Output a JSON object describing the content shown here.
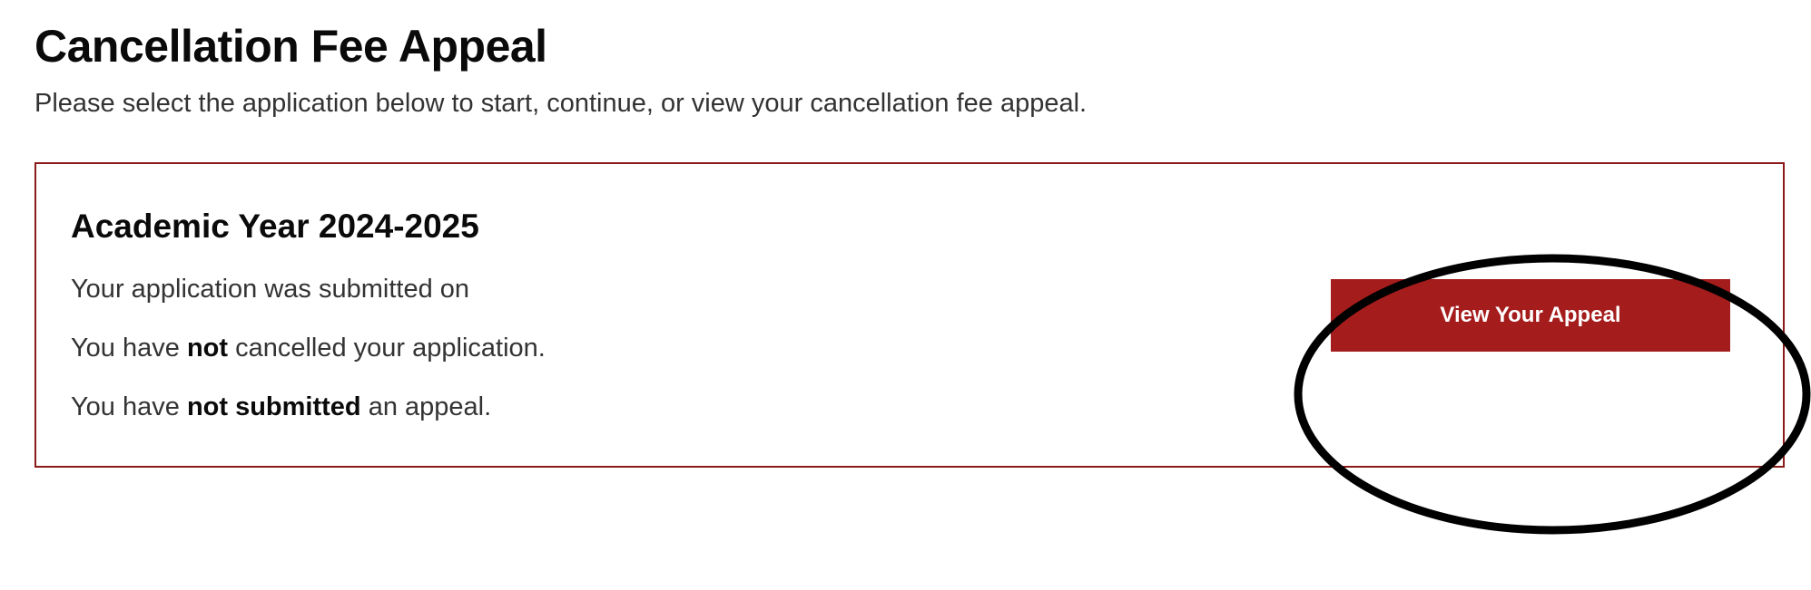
{
  "header": {
    "title": "Cancellation Fee Appeal",
    "subtitle": "Please select the application below to start, continue, or view your cancellation fee appeal."
  },
  "card": {
    "title": "Academic Year 2024-2025",
    "status": {
      "submitted_prefix": "Your application was submitted on",
      "submitted_date": "",
      "cancel_prefix": "You have ",
      "cancel_bold": "not",
      "cancel_suffix": " cancelled your application.",
      "appeal_prefix": "You have ",
      "appeal_bold": "not submitted",
      "appeal_suffix": " an appeal."
    },
    "button_label": "View Your Appeal"
  },
  "colors": {
    "brand_red": "#a51c1c",
    "border_red": "#8b1a1a"
  }
}
